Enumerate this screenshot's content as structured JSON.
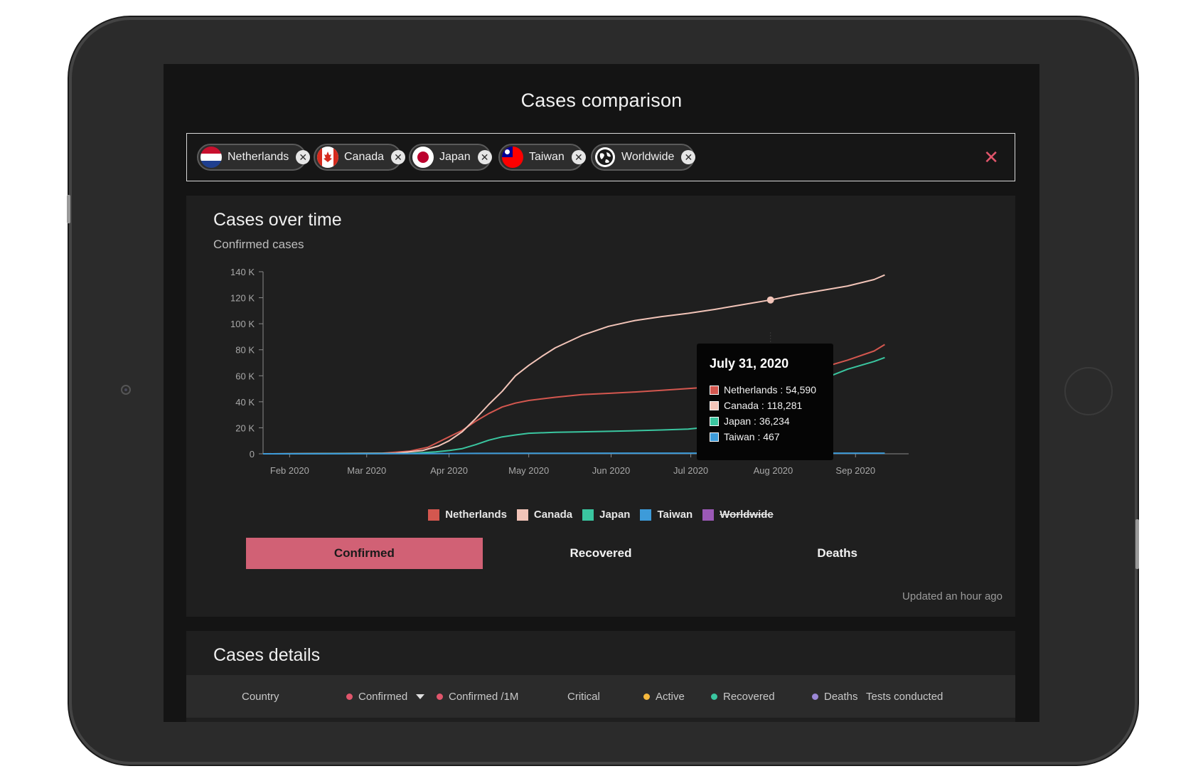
{
  "page": {
    "title": "Cases comparison"
  },
  "chips": [
    {
      "label": "Netherlands",
      "flag": "netherlands-flag-icon"
    },
    {
      "label": "Canada",
      "flag": "canada-flag-icon"
    },
    {
      "label": "Japan",
      "flag": "japan-flag-icon"
    },
    {
      "label": "Taiwan",
      "flag": "taiwan-flag-icon"
    },
    {
      "label": "Worldwide",
      "flag": "globe-icon"
    }
  ],
  "clear_all_glyph": "✕",
  "chip_remove_glyph": "✕",
  "card": {
    "title": "Cases over time",
    "subtitle": "Confirmed cases",
    "updated": "Updated an hour ago"
  },
  "tabs": [
    {
      "label": "Confirmed",
      "active": true
    },
    {
      "label": "Recovered",
      "active": false
    },
    {
      "label": "Deaths",
      "active": false
    }
  ],
  "tooltip": {
    "date": "July 31, 2020",
    "rows": [
      {
        "label": "Netherlands : 54,590",
        "color": "#d4574f"
      },
      {
        "label": "Canada : 118,281",
        "color": "#f2c4b8"
      },
      {
        "label": "Japan : 36,234",
        "color": "#3ac6a0"
      },
      {
        "label": "Taiwan : 467",
        "color": "#3d9bd9"
      }
    ]
  },
  "chart_data": {
    "type": "line",
    "ylim": [
      0,
      140000
    ],
    "y_ticks": [
      "0",
      "20 K",
      "40 K",
      "60 K",
      "80 K",
      "100 K",
      "120 K",
      "140 K"
    ],
    "y_tick_values": [
      0,
      20000,
      40000,
      60000,
      80000,
      100000,
      120000,
      140000
    ],
    "x_ticks": [
      "Feb 2020",
      "Mar 2020",
      "Apr 2020",
      "May 2020",
      "Jun 2020",
      "Jul 2020",
      "Aug 2020",
      "Sep 2020"
    ],
    "x_tick_days": [
      10,
      39,
      70,
      100,
      131,
      161,
      192,
      223
    ],
    "xlim_days": [
      0,
      243
    ],
    "hover_day": 191,
    "grid": false,
    "legend_position": "bottom",
    "series": [
      {
        "name": "Netherlands",
        "color": "#d4574f",
        "visible": true,
        "days": [
          0,
          45,
          55,
          62,
          66,
          70,
          75,
          80,
          85,
          90,
          95,
          100,
          110,
          120,
          130,
          140,
          150,
          160,
          170,
          180,
          191,
          200,
          210,
          220,
          230,
          234
        ],
        "values": [
          0,
          500,
          2000,
          5000,
          9000,
          13000,
          18000,
          25000,
          31000,
          36000,
          39000,
          41000,
          43500,
          45500,
          46500,
          47500,
          48800,
          50200,
          51500,
          52500,
          54590,
          59000,
          66000,
          72000,
          79000,
          84000
        ]
      },
      {
        "name": "Canada",
        "color": "#f2c4b8",
        "visible": true,
        "days": [
          0,
          50,
          60,
          66,
          70,
          75,
          80,
          85,
          90,
          95,
          100,
          105,
          110,
          120,
          130,
          140,
          150,
          160,
          170,
          180,
          191,
          200,
          210,
          220,
          230,
          234
        ],
        "values": [
          0,
          500,
          2500,
          6000,
          10000,
          17000,
          27000,
          38000,
          48000,
          60000,
          68000,
          75000,
          81500,
          91000,
          98000,
          102500,
          105500,
          108000,
          111000,
          114500,
          118281,
          122000,
          125500,
          129000,
          134000,
          137500
        ]
      },
      {
        "name": "Japan",
        "color": "#3ac6a0",
        "visible": true,
        "days": [
          0,
          55,
          65,
          70,
          75,
          80,
          85,
          90,
          95,
          100,
          110,
          120,
          130,
          140,
          150,
          160,
          170,
          175,
          180,
          185,
          191,
          195,
          200,
          210,
          220,
          230,
          234
        ],
        "values": [
          0,
          300,
          1500,
          2500,
          4000,
          7000,
          10500,
          13000,
          14500,
          15800,
          16500,
          16900,
          17300,
          17800,
          18300,
          19000,
          21000,
          23000,
          26000,
          30000,
          36234,
          41000,
          48000,
          57000,
          65000,
          71000,
          74000
        ]
      },
      {
        "name": "Taiwan",
        "color": "#3d9bd9",
        "visible": true,
        "days": [
          0,
          60,
          80,
          100,
          191,
          234
        ],
        "values": [
          0,
          100,
          350,
          430,
          467,
          500
        ]
      },
      {
        "name": "Worldwide",
        "color": "#9b59b6",
        "visible": false,
        "days": [],
        "values": []
      }
    ]
  },
  "details": {
    "title": "Cases details",
    "columns": [
      {
        "label": "Country",
        "dot": null
      },
      {
        "label": "Confirmed",
        "dot": "#e0556b",
        "sort": true
      },
      {
        "label": "Confirmed /1M",
        "dot": "#e0556b"
      },
      {
        "label": "Critical",
        "dot": null
      },
      {
        "label": "Active",
        "dot": "#f5b83d"
      },
      {
        "label": "Recovered",
        "dot": "#3ac6a0"
      },
      {
        "label": "Deaths",
        "dot": "#9b87d6"
      },
      {
        "label": "Tests conducted",
        "dot": null
      }
    ]
  }
}
